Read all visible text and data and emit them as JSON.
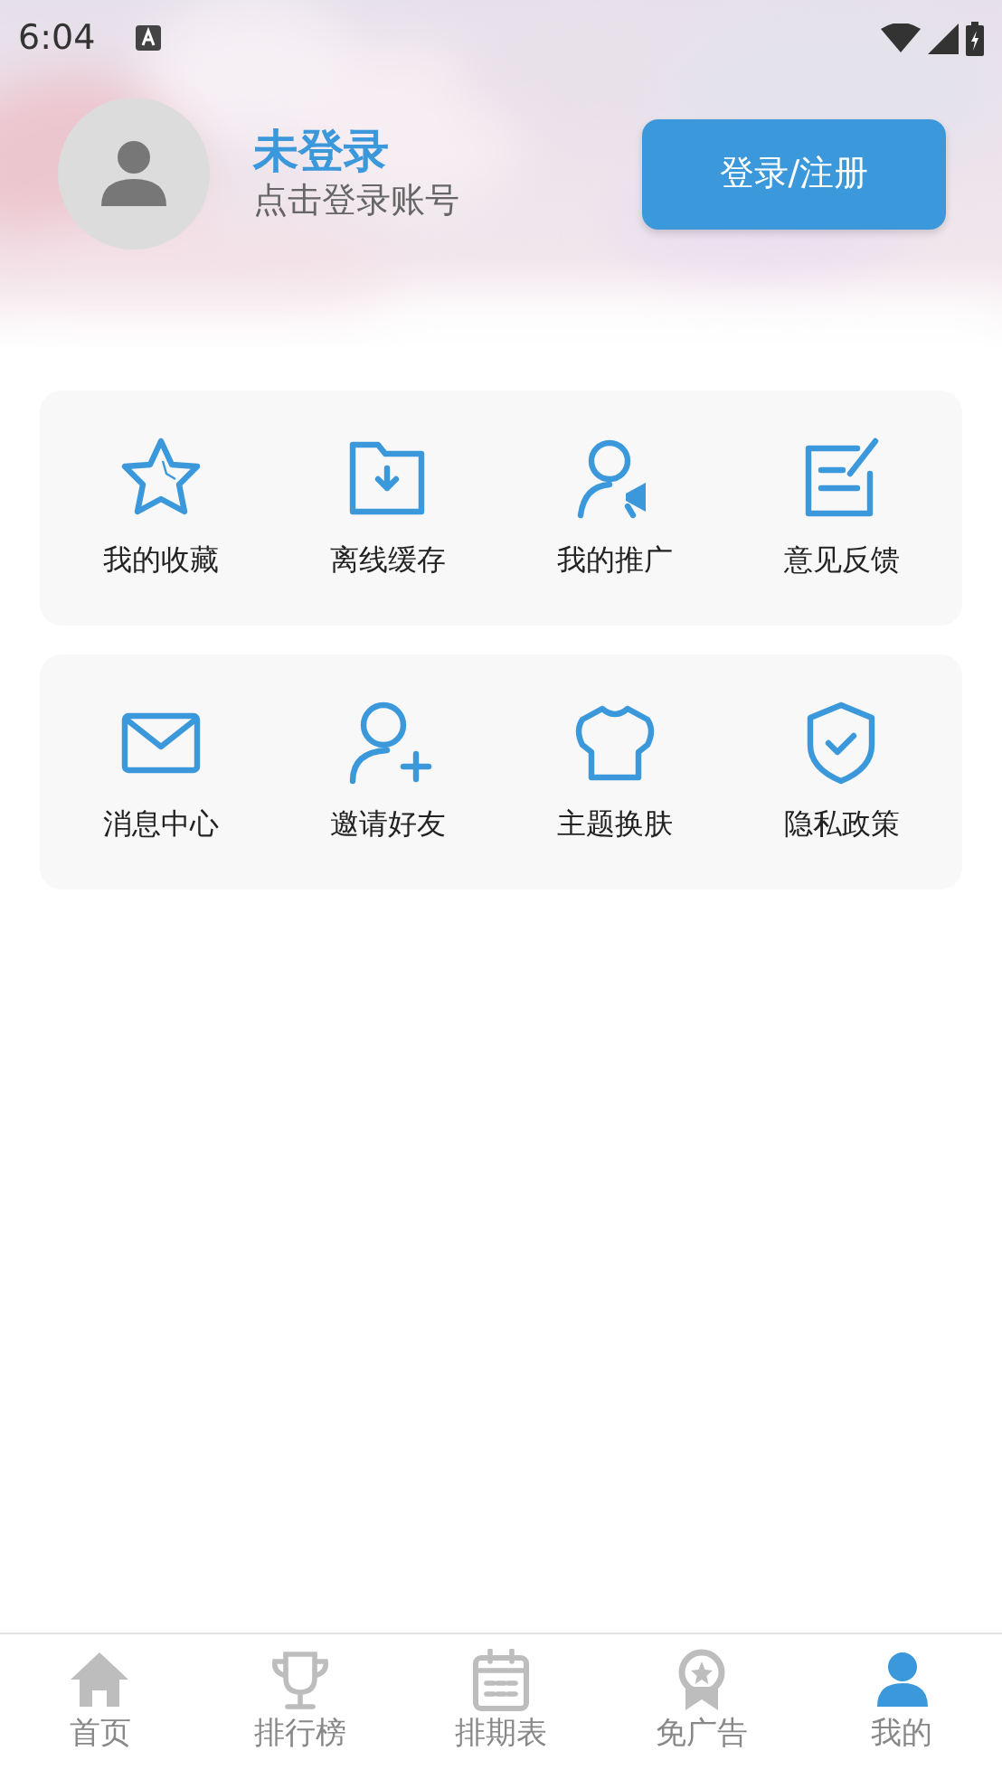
{
  "status_bar": {
    "time": "6:04"
  },
  "profile": {
    "name": "未登录",
    "subtitle": "点击登录账号",
    "login_button": "登录/注册"
  },
  "menu_groups": [
    {
      "items": [
        {
          "label": "我的收藏"
        },
        {
          "label": "离线缓存"
        },
        {
          "label": "我的推广"
        },
        {
          "label": "意见反馈"
        }
      ]
    },
    {
      "items": [
        {
          "label": "消息中心"
        },
        {
          "label": "邀请好友"
        },
        {
          "label": "主题换肤"
        },
        {
          "label": "隐私政策"
        }
      ]
    }
  ],
  "tabs": [
    {
      "label": "首页",
      "selected": false
    },
    {
      "label": "排行榜",
      "selected": false
    },
    {
      "label": "排期表",
      "selected": false
    },
    {
      "label": "免广告",
      "selected": false
    },
    {
      "label": "我的",
      "selected": true
    }
  ]
}
